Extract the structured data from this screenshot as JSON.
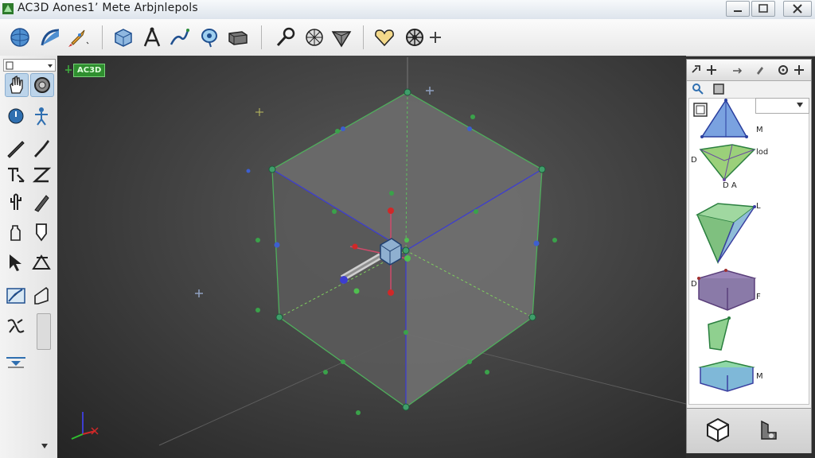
{
  "window": {
    "title": "AC3D Aones1’ Mete Arbjnlepols"
  },
  "viewport": {
    "badge": "AC3D"
  },
  "icons": {
    "toolbar": [
      "sphere-icon",
      "curve-icon",
      "rocket-icon",
      "cube-icon",
      "compass-icon",
      "fork-icon",
      "lasso-icon",
      "box-icon",
      "wrench-icon",
      "grid-sphere-icon",
      "cone-icon",
      "heart-icon",
      "wheel-icon",
      "plus-icon"
    ],
    "left": [
      "hand-icon",
      "orbit-icon",
      "rotate-icon",
      "figure-icon",
      "pencil-icon",
      "brush-icon",
      "text-tool-icon",
      "zig-icon",
      "cactus-icon",
      "knife-icon",
      "bottle-icon",
      "pin-icon",
      "cursor-icon",
      "triangle-tool-icon",
      "image-icon",
      "fold-icon",
      "split-icon",
      "scroll-handle",
      "ruler-icon"
    ]
  },
  "panel": {
    "items": [
      {
        "labels": [
          "M"
        ]
      },
      {
        "labels": [
          "D",
          "lod",
          "D A"
        ]
      },
      {
        "labels": [
          "L"
        ]
      },
      {
        "labels": [
          "D",
          "F"
        ]
      },
      {
        "labels": []
      },
      {
        "labels": [
          "M"
        ]
      }
    ]
  },
  "colors": {
    "accent": "#3a6fb5",
    "viewport_bg": "#3c3c3c",
    "cube_edge_blue": "#3d3dd0",
    "cube_edge_green": "#4fae5c",
    "vertex_green": "#3f9e6a",
    "handle_red": "#d02828"
  }
}
